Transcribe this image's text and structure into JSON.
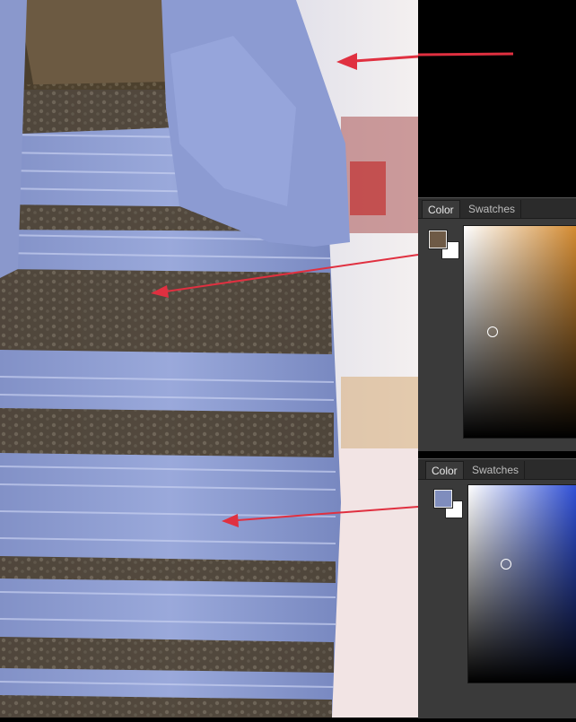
{
  "panels": [
    {
      "tabs": [
        "Color",
        "Swatches"
      ],
      "foreground_color": "#6e5a46",
      "field_hue_color": "#d38a30",
      "picker_position": {
        "saturation": 0.25,
        "brightness": 0.5
      },
      "description": "top color panel"
    },
    {
      "tabs": [
        "Color",
        "Swatches"
      ],
      "foreground_color": "#7f8dbd",
      "field_hue_color": "#2f4fd6",
      "picker_position": {
        "saturation": 0.35,
        "brightness": 0.6
      },
      "description": "bottom color panel"
    }
  ],
  "colors": {
    "dress_blue": "#8b9ccf",
    "lace_dark": "#4a3e2c",
    "arrow_red": "#e03040"
  }
}
